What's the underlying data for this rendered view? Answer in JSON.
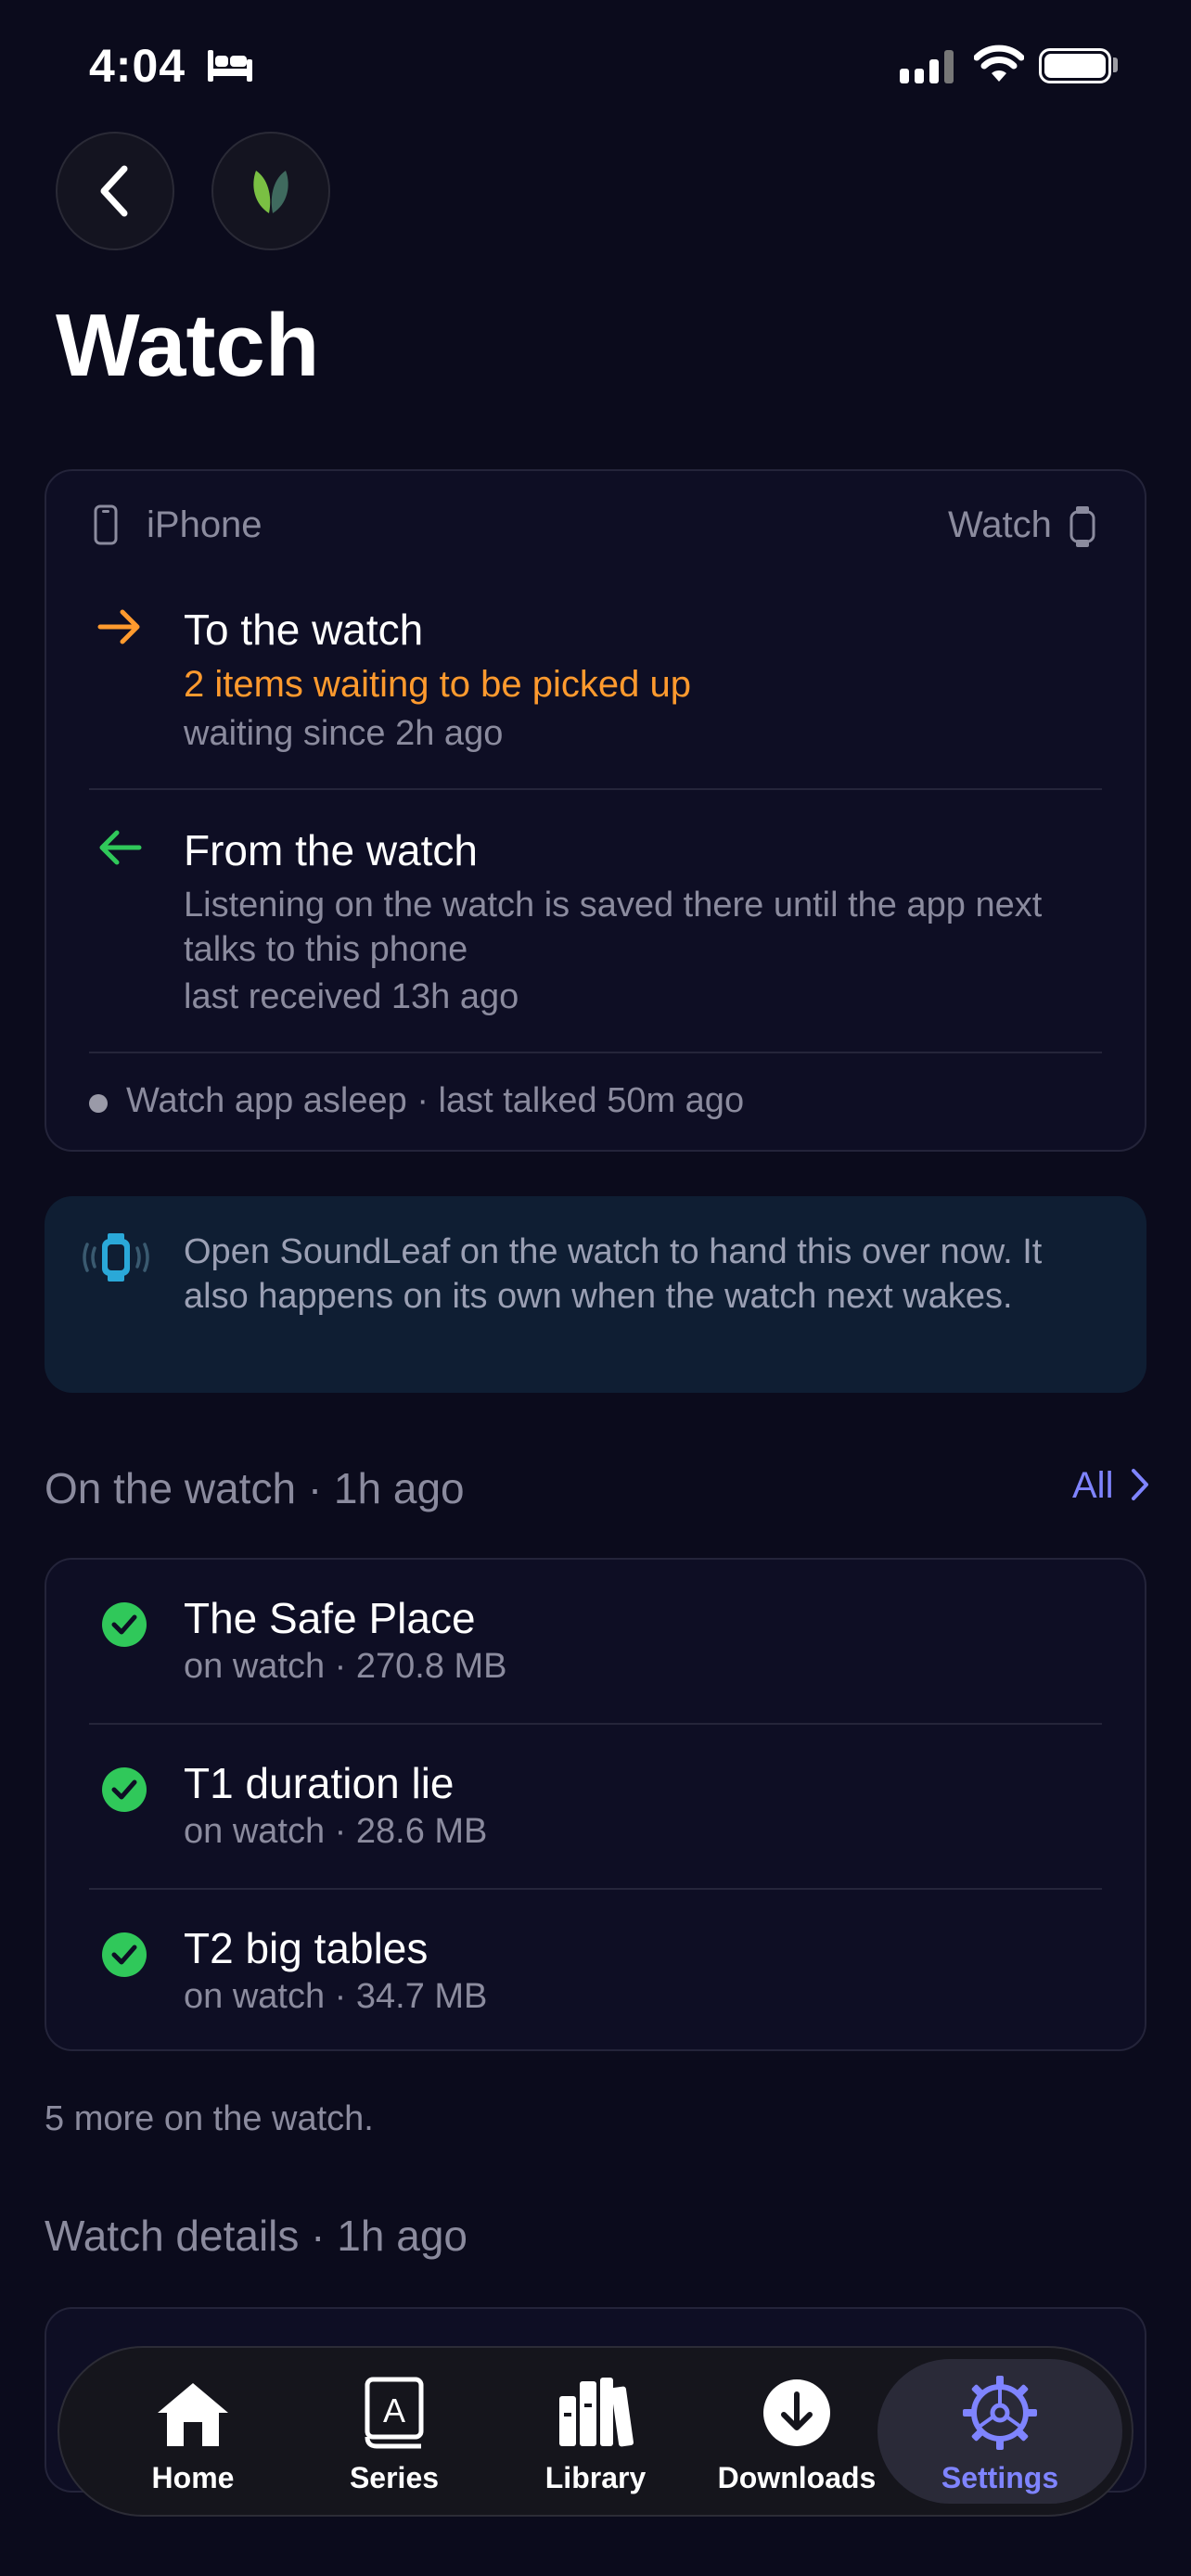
{
  "status_bar": {
    "time": "4:04"
  },
  "header": {
    "title": "Watch"
  },
  "sync": {
    "left_label": "iPhone",
    "right_label": "Watch",
    "to_watch": {
      "title": "To the watch",
      "status": "2 items waiting to be picked up",
      "since": "waiting since 2h ago"
    },
    "from_watch": {
      "title": "From the watch",
      "description": "Listening on the watch is saved there until the app next talks to this phone",
      "last": "last received 13h ago"
    },
    "footer": "Watch app asleep · last talked 50m ago"
  },
  "info": {
    "text": "Open SoundLeaf on the watch to hand this over now. It also happens on its own when the watch next wakes."
  },
  "on_watch": {
    "title": "On the watch · 1h ago",
    "all_label": "All",
    "items": [
      {
        "title": "The Safe Place",
        "sub": "on watch · 270.8 MB"
      },
      {
        "title": "T1 duration lie",
        "sub": "on watch · 28.6 MB"
      },
      {
        "title": "T2 big tables",
        "sub": "on watch · 34.7 MB"
      }
    ],
    "more": "5 more on the watch."
  },
  "details": {
    "title": "Watch details · 1h ago"
  },
  "tabs": [
    {
      "label": "Home",
      "icon": "home-icon"
    },
    {
      "label": "Series",
      "icon": "book-icon"
    },
    {
      "label": "Library",
      "icon": "library-icon"
    },
    {
      "label": "Downloads",
      "icon": "download-icon"
    },
    {
      "label": "Settings",
      "icon": "gear-icon",
      "active": true
    }
  ],
  "colors": {
    "accent": "#7f84ff",
    "orange": "#ff9a2e",
    "green": "#30c85a",
    "background": "#0b0b1c"
  }
}
